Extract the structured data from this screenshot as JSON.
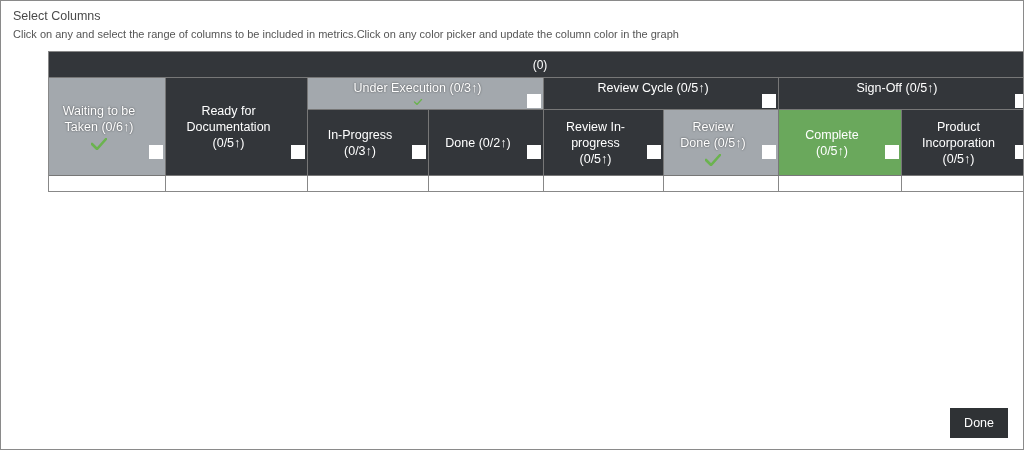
{
  "dialog": {
    "title": "Select Columns",
    "instructions": "Click on any and select the range of columns to be included in metrics.Click on any color picker and update the column color in the graph"
  },
  "table": {
    "root": {
      "label": "(0)"
    },
    "columns": [
      {
        "label": "Waiting to be Taken (0/6↑)",
        "selected": true,
        "color": "#a3a8ad"
      },
      {
        "label": "Ready for Documentation (0/5↑)",
        "selected": false,
        "color": "#33363a"
      },
      {
        "label": "Under Execution (0/3↑)",
        "selected": true,
        "color": "#a3a8ad",
        "children": [
          {
            "label": "In-Progress (0/3↑)",
            "selected": false,
            "color": "#33363a"
          },
          {
            "label": "Done (0/2↑)",
            "selected": false,
            "color": "#33363a"
          }
        ]
      },
      {
        "label": "Review Cycle (0/5↑)",
        "selected": false,
        "color": "#33363a",
        "children": [
          {
            "label": "Review In-progress (0/5↑)",
            "selected": false,
            "color": "#33363a"
          },
          {
            "label": "Review Done (0/5↑)",
            "selected": true,
            "color": "#a3a8ad"
          }
        ]
      },
      {
        "label": "Sign-Off (0/5↑)",
        "selected": false,
        "color": "#33363a",
        "children": [
          {
            "label": "Complete (0/5↑)",
            "selected": false,
            "color": "#6aa85c"
          },
          {
            "label": "Product Incorporation (0/5↑)",
            "selected": false,
            "color": "#33363a"
          }
        ]
      }
    ]
  },
  "buttons": [
    {
      "label": "Done"
    }
  ]
}
